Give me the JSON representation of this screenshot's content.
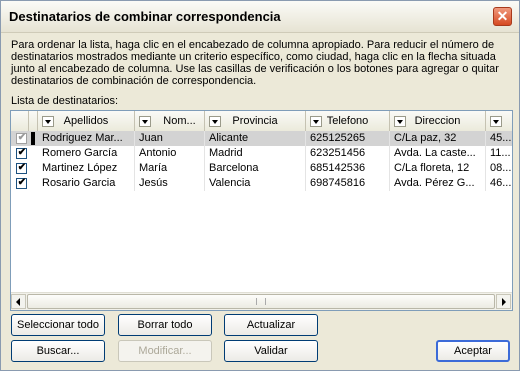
{
  "dialog": {
    "title": "Destinatarios de combinar correspondencia",
    "close_glyph": "✕",
    "description": "Para ordenar la lista, haga clic en el encabezado de columna apropiado. Para reducir el número de destinatarios mostrados mediante un criterio específico, como ciudad, haga clic en la flecha situada junto al encabezado de columna. Use las casillas de verificación o los botones para agregar o quitar destinatarios de combinación de correspondencia.",
    "list_label": "Lista de destinatarios:"
  },
  "grid": {
    "columns": [
      "Apellidos",
      "Nom...",
      "Provincia",
      "Telefono",
      "Direccion",
      ""
    ],
    "rows": [
      {
        "checked": true,
        "selected": true,
        "cells": [
          "Rodriguez Mar...",
          "Juan",
          "Alicante",
          "625125265",
          "C/La paz, 32",
          "45..."
        ]
      },
      {
        "checked": true,
        "selected": false,
        "cells": [
          "Romero García",
          "Antonio",
          "Madrid",
          "623251456",
          "Avda. La caste...",
          "11..."
        ]
      },
      {
        "checked": true,
        "selected": false,
        "cells": [
          "Martinez López",
          "María",
          "Barcelona",
          "685142536",
          "C/La floreta, 12",
          "08..."
        ]
      },
      {
        "checked": true,
        "selected": false,
        "cells": [
          "Rosario Garcia",
          "Jesús",
          "Valencia",
          "698745816",
          "Avda. Pérez G...",
          "46..."
        ]
      }
    ],
    "check_glyph": "✔"
  },
  "buttons": {
    "select_all": "Seleccionar todo",
    "clear_all": "Borrar todo",
    "refresh": "Actualizar",
    "find": "Buscar...",
    "edit": "Modificar...",
    "validate": "Validar",
    "ok": "Aceptar"
  },
  "colors": {
    "accent": "#3c6bd8",
    "dialog_bg": "#ece9d8",
    "close_button": "#d64a22"
  }
}
